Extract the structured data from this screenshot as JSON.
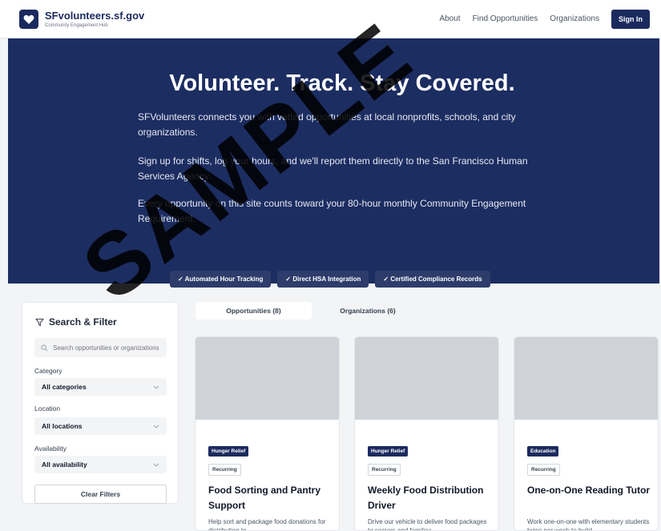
{
  "header": {
    "brand_name": "SFvolunteers.sf.gov",
    "brand_sub": "Community Engagement Hub",
    "nav": [
      "About",
      "Find Opportunities",
      "Organizations"
    ],
    "signin_label": "Sign In"
  },
  "hero": {
    "title": "Volunteer. Track. Stay Covered.",
    "p1": "SFVolunteers connects you with vetted opportunities at local nonprofits, schools, and city organizations.",
    "p2": "Sign up for shifts, log your hours, and we'll report them directly to the San Francisco Human Services Agency.",
    "p3": "Every opportunity on this site counts toward your 80-hour monthly Community Engagement Requirement.",
    "pills": [
      "✓ Automated Hour Tracking",
      "✓ Direct HSA Integration",
      "✓ Certified Compliance Records"
    ]
  },
  "filter": {
    "title": "Search & Filter",
    "search_placeholder": "Search opportunities or organizations",
    "category_label": "Category",
    "category_value": "All categories",
    "location_label": "Location",
    "location_value": "All locations",
    "availability_label": "Availability",
    "availability_value": "All availability",
    "clear_label": "Clear Filters"
  },
  "tabs": {
    "opportunities": "Opportunities (8)",
    "organizations": "Organizations (6)"
  },
  "cards": [
    {
      "badge": "Hunger Relief",
      "tag": "Recurring",
      "title": "Food Sorting and Pantry Support",
      "desc": "Help sort and package food donations for distribution to"
    },
    {
      "badge": "Hunger Relief",
      "tag": "Recurring",
      "title": "Weekly Food Distribution Driver",
      "desc": "Drive our vehicle to deliver food packages to seniors and families"
    },
    {
      "badge": "Education",
      "tag": "Recurring",
      "title": "One-on-One Reading Tutor",
      "desc": "Work one-on-one with elementary students twice per week to build"
    }
  ],
  "watermark": "SAMPLE"
}
